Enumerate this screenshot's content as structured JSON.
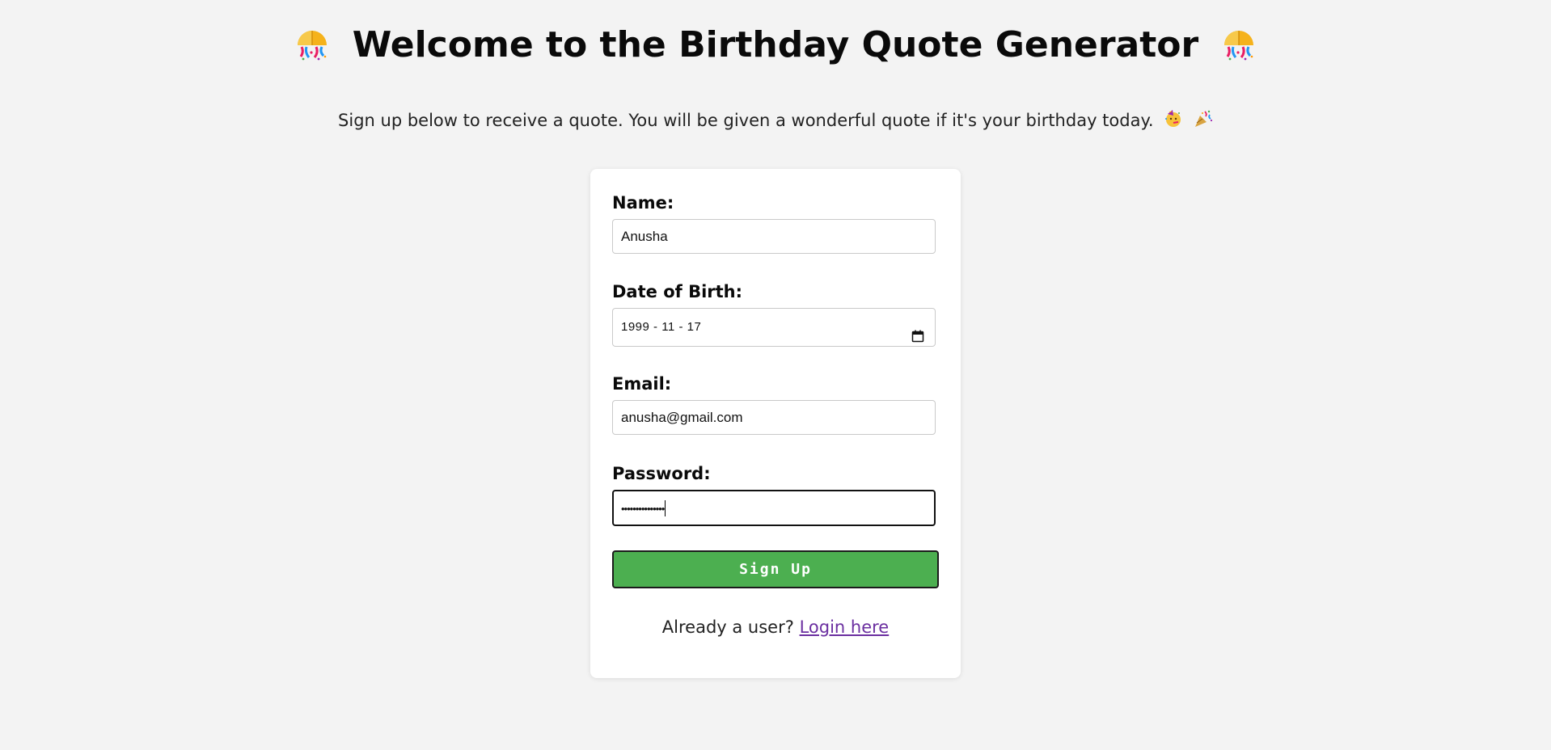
{
  "header": {
    "title": "Welcome to the Birthday Quote Generator",
    "left_icon": "confetti-ball-icon",
    "right_icon": "confetti-ball-icon"
  },
  "subtitle": {
    "text": "Sign up below to receive a quote. You will be given a wonderful quote if it's your birthday today.",
    "icons": [
      "partying-face-icon",
      "party-popper-icon"
    ]
  },
  "form": {
    "name_label": "Name:",
    "name_value": "Anusha",
    "dob_label": "Date of Birth:",
    "dob_value": "1999 - 11 - 17",
    "email_label": "Email:",
    "email_value": "anusha@gmail.com",
    "password_label": "Password:",
    "password_masked": "•••••••••••••••",
    "submit_label": "Sign Up"
  },
  "footer": {
    "prompt": "Already a user?",
    "login_link": "Login here"
  },
  "colors": {
    "page_background": "#f3f3f3",
    "card_background": "#ffffff",
    "button_green": "#4caf50",
    "link_purple": "#6b2fa0"
  }
}
